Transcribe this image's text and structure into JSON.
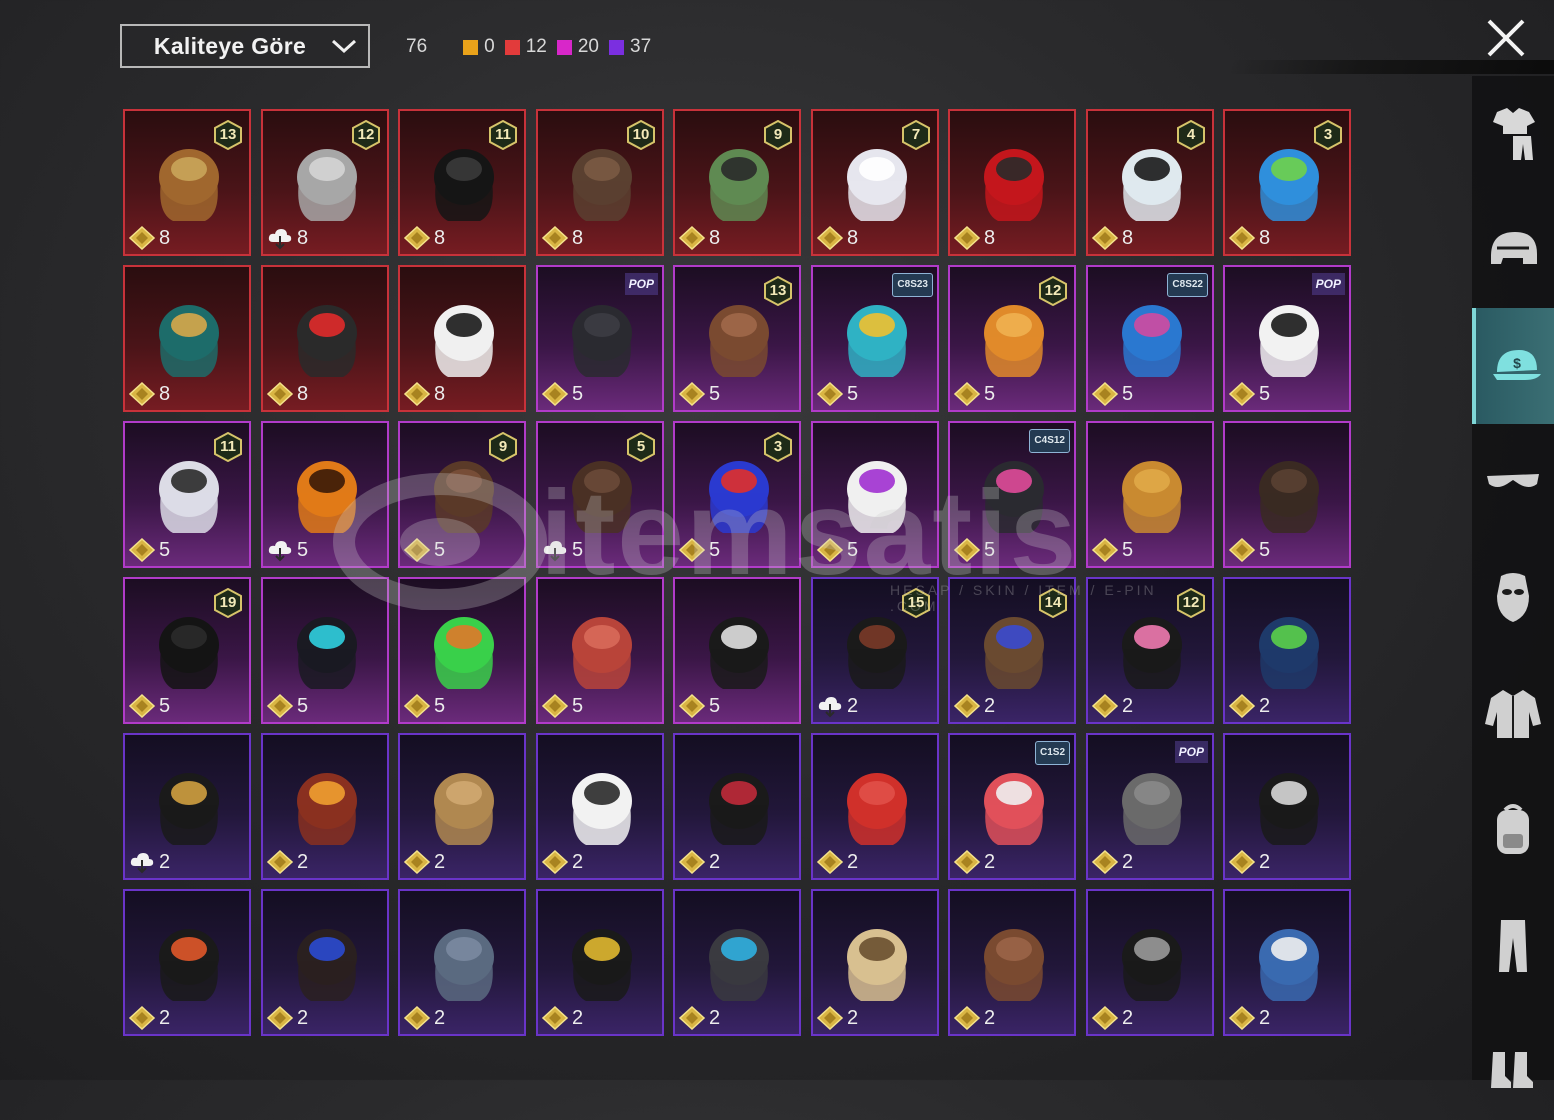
{
  "header": {
    "sort_label": "Kaliteye Göre",
    "total_count": "76",
    "quality_counts": [
      {
        "color": "#e9a21a",
        "value": "0"
      },
      {
        "color": "#e23b3b",
        "value": "12"
      },
      {
        "color": "#d827c9",
        "value": "20"
      },
      {
        "color": "#7b2fe0",
        "value": "37"
      }
    ]
  },
  "watermark": {
    "text": "itemsatis",
    "subtext": "HESAP / SKIN / ITEM / E-PIN .COM"
  },
  "sidebar": {
    "tabs": [
      {
        "name": "outfit-icon",
        "active": false
      },
      {
        "name": "helmet-icon",
        "active": false
      },
      {
        "name": "hat-icon",
        "active": true
      },
      {
        "name": "glasses-icon",
        "active": false
      },
      {
        "name": "mask-icon",
        "active": false
      },
      {
        "name": "jacket-icon",
        "active": false
      },
      {
        "name": "backpack-icon",
        "active": false
      },
      {
        "name": "pants-icon",
        "active": false
      },
      {
        "name": "shoes-icon",
        "active": false
      }
    ]
  },
  "items": [
    {
      "quality": "red",
      "icon": "hat-with-hair",
      "badge": "13",
      "currency": "coin",
      "value": "8"
    },
    {
      "quality": "red",
      "icon": "gray-hair",
      "badge": "12",
      "currency": "cloud",
      "value": "8"
    },
    {
      "quality": "red",
      "icon": "black-hair",
      "badge": "11",
      "currency": "coin",
      "value": "8"
    },
    {
      "quality": "red",
      "icon": "braided-hair",
      "badge": "10",
      "currency": "coin",
      "value": "8"
    },
    {
      "quality": "red",
      "icon": "zombie-head",
      "badge": "9",
      "currency": "coin",
      "value": "8"
    },
    {
      "quality": "red",
      "icon": "white-hair",
      "badge": "7",
      "currency": "coin",
      "value": "8"
    },
    {
      "quality": "red",
      "icon": "red-helmet",
      "badge": "",
      "currency": "coin",
      "value": "8"
    },
    {
      "quality": "red",
      "icon": "snowman-tophat",
      "badge": "4",
      "currency": "coin",
      "value": "8"
    },
    {
      "quality": "red",
      "icon": "clown-head",
      "badge": "3",
      "currency": "coin",
      "value": "8"
    },
    {
      "quality": "red",
      "icon": "dragon-mask",
      "badge": "",
      "currency": "coin",
      "value": "8"
    },
    {
      "quality": "red",
      "icon": "oni-mask",
      "badge": "",
      "currency": "coin",
      "value": "8"
    },
    {
      "quality": "red",
      "icon": "jester-hood",
      "badge": "",
      "currency": "coin",
      "value": "8"
    },
    {
      "quality": "purple",
      "icon": "dark-hair",
      "tag": "POP",
      "tagtype": "pop",
      "currency": "coin",
      "value": "5"
    },
    {
      "quality": "purple",
      "icon": "aviator-cap",
      "badge": "13",
      "currency": "coin",
      "value": "5"
    },
    {
      "quality": "purple",
      "icon": "cat-headphones",
      "tag": "C8S23",
      "tagtype": "hex",
      "currency": "coin",
      "value": "5"
    },
    {
      "quality": "purple",
      "icon": "orange-pigtails",
      "badge": "12",
      "currency": "coin",
      "value": "5"
    },
    {
      "quality": "purple",
      "icon": "blue-pink-hair",
      "tag": "C8S22",
      "tagtype": "hex",
      "currency": "coin",
      "value": "5"
    },
    {
      "quality": "purple",
      "icon": "panda-head",
      "tag": "POP",
      "tagtype": "pop",
      "currency": "coin",
      "value": "5"
    },
    {
      "quality": "purple",
      "icon": "flower-veil",
      "badge": "11",
      "currency": "coin",
      "value": "5"
    },
    {
      "quality": "purple",
      "icon": "pumpkin-head",
      "badge": "",
      "currency": "cloud",
      "value": "5"
    },
    {
      "quality": "purple",
      "icon": "brown-hair",
      "badge": "9",
      "currency": "coin",
      "value": "5"
    },
    {
      "quality": "purple",
      "icon": "ponytail",
      "badge": "5",
      "currency": "cloud",
      "value": "5"
    },
    {
      "quality": "purple",
      "icon": "jester-hat",
      "badge": "3",
      "currency": "coin",
      "value": "5"
    },
    {
      "quality": "purple",
      "icon": "bunny-mask",
      "badge": "",
      "currency": "coin",
      "value": "5"
    },
    {
      "quality": "purple",
      "icon": "visor-cap",
      "tag": "C4S12",
      "tagtype": "hex",
      "currency": "coin",
      "value": "5"
    },
    {
      "quality": "purple",
      "icon": "potato-head",
      "badge": "",
      "currency": "coin",
      "value": "5"
    },
    {
      "quality": "purple",
      "icon": "long-hair-bow",
      "badge": "",
      "currency": "coin",
      "value": "5"
    },
    {
      "quality": "purple",
      "icon": "black-bun",
      "badge": "19",
      "currency": "coin",
      "value": "5"
    },
    {
      "quality": "purple",
      "icon": "cyber-ears",
      "badge": "",
      "currency": "coin",
      "value": "5"
    },
    {
      "quality": "purple",
      "icon": "frog-hat",
      "badge": "",
      "currency": "coin",
      "value": "5"
    },
    {
      "quality": "purple",
      "icon": "dino-head",
      "badge": "",
      "currency": "coin",
      "value": "5"
    },
    {
      "quality": "purple",
      "icon": "skull-balaclava",
      "badge": "",
      "currency": "coin",
      "value": "5"
    },
    {
      "quality": "violet",
      "icon": "pumpkin-beanie",
      "badge": "15",
      "currency": "cloud",
      "value": "2"
    },
    {
      "quality": "violet",
      "icon": "cap-long-hair",
      "badge": "14",
      "currency": "coin",
      "value": "2"
    },
    {
      "quality": "violet",
      "icon": "bunny-helmet",
      "badge": "12",
      "currency": "coin",
      "value": "2"
    },
    {
      "quality": "violet",
      "icon": "gas-helmet",
      "badge": "",
      "currency": "coin",
      "value": "2"
    },
    {
      "quality": "violet",
      "icon": "moto-helmet",
      "badge": "",
      "currency": "cloud",
      "value": "2"
    },
    {
      "quality": "violet",
      "icon": "goggle-hair",
      "badge": "",
      "currency": "coin",
      "value": "2"
    },
    {
      "quality": "violet",
      "icon": "wavy-hair",
      "badge": "",
      "currency": "coin",
      "value": "2"
    },
    {
      "quality": "violet",
      "icon": "white-sunhat",
      "badge": "",
      "currency": "coin",
      "value": "2"
    },
    {
      "quality": "violet",
      "icon": "bucket-hat",
      "badge": "",
      "currency": "coin",
      "value": "2"
    },
    {
      "quality": "violet",
      "icon": "red-fez",
      "badge": "",
      "currency": "coin",
      "value": "2"
    },
    {
      "quality": "violet",
      "icon": "striped-beanie",
      "tag": "C1S2",
      "tagtype": "hex",
      "currency": "coin",
      "value": "2"
    },
    {
      "quality": "violet",
      "icon": "gray-bob",
      "tag": "POP",
      "tagtype": "pop",
      "currency": "coin",
      "value": "2"
    },
    {
      "quality": "violet",
      "icon": "witch-hat",
      "badge": "",
      "currency": "coin",
      "value": "2"
    },
    {
      "quality": "violet",
      "icon": "ponytail-helmet",
      "badge": "",
      "currency": "coin",
      "value": "2"
    },
    {
      "quality": "violet",
      "icon": "headband-hair",
      "badge": "",
      "currency": "coin",
      "value": "2"
    },
    {
      "quality": "violet",
      "icon": "baseball-cap",
      "badge": "",
      "currency": "coin",
      "value": "2"
    },
    {
      "quality": "violet",
      "icon": "fedora",
      "badge": "",
      "currency": "coin",
      "value": "2"
    },
    {
      "quality": "violet",
      "icon": "goggle-beanie",
      "badge": "",
      "currency": "coin",
      "value": "2"
    },
    {
      "quality": "violet",
      "icon": "straw-hat",
      "badge": "",
      "currency": "coin",
      "value": "2"
    },
    {
      "quality": "violet",
      "icon": "cowboy-hat",
      "badge": "",
      "currency": "coin",
      "value": "2"
    },
    {
      "quality": "violet",
      "icon": "luchador-mask",
      "badge": "",
      "currency": "coin",
      "value": "2"
    },
    {
      "quality": "violet",
      "icon": "shark-hat",
      "badge": "",
      "currency": "coin",
      "value": "2"
    }
  ]
}
